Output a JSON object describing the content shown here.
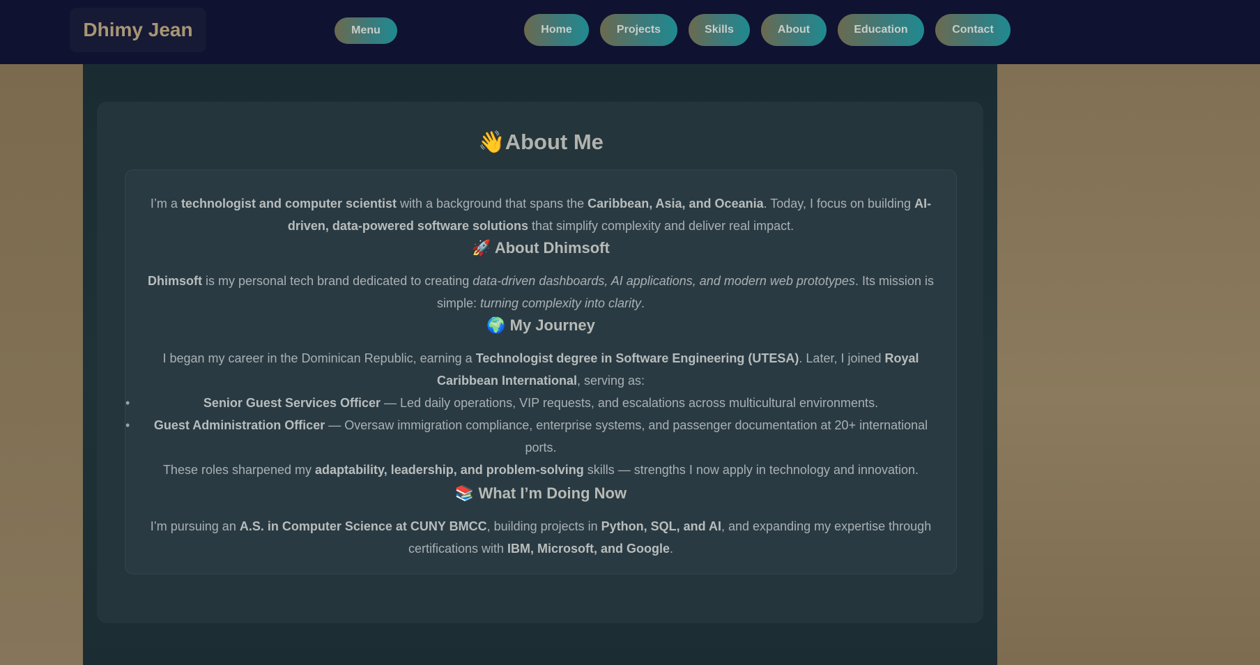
{
  "brand": {
    "name": "Dhimy Jean"
  },
  "nav": {
    "menu_label": "Menu",
    "links": [
      "Home",
      "Projects",
      "Skills",
      "About",
      "Education",
      "Contact"
    ]
  },
  "about": {
    "title_emoji": "👋",
    "title": "About Me",
    "intro": {
      "t1": "I’m a ",
      "b1": "technologist and computer scientist",
      "t2": " with a background that spans the ",
      "b2": "Caribbean, Asia, and Oceania",
      "t3": ". Today, I focus on building ",
      "b3": "AI-driven, data-powered software solutions",
      "t4": " that simplify complexity and deliver real impact."
    },
    "dhimsoft": {
      "heading_emoji": "🚀",
      "heading": "About Dhimsoft",
      "b1": "Dhimsoft",
      "t1": " is my personal tech brand dedicated to creating ",
      "i1": "data-driven dashboards, AI applications, and modern web prototypes",
      "t2": ". Its mission is simple: ",
      "i2": "turning complexity into clarity",
      "t3": "."
    },
    "journey": {
      "heading_emoji": "🌍",
      "heading": "My Journey",
      "t1": "I began my career in the Dominican Republic, earning a ",
      "b1": "Technologist degree in Software Engineering (UTESA)",
      "t2": ". Later, I joined ",
      "b2": "Royal Caribbean International",
      "t3": ", serving as:",
      "roles": [
        {
          "title": "Senior Guest Services Officer",
          "desc": " — Led daily operations, VIP requests, and escalations across multicultural environments."
        },
        {
          "title": "Guest Administration Officer",
          "desc": " — Oversaw immigration compliance, enterprise systems, and passenger documentation at 20+ international ports."
        }
      ],
      "s1": "These roles sharpened my ",
      "sb": "adaptability, leadership, and problem-solving",
      "s2": " skills — strengths I now apply in technology and innovation."
    },
    "now": {
      "heading_emoji": "📚",
      "heading": "What I’m Doing Now",
      "t1": "I’m pursuing an ",
      "b1": "A.S. in Computer Science at CUNY BMCC",
      "t2": ", building projects in ",
      "b2": "Python, SQL, and AI",
      "t3": ", and expanding my expertise through certifications with ",
      "b3": "IBM, Microsoft, and Google",
      "t4": "."
    }
  }
}
